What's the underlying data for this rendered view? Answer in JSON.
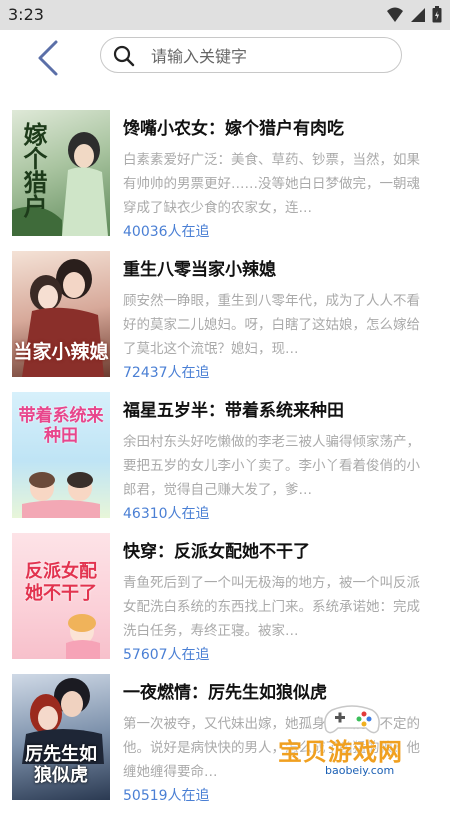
{
  "status_bar": {
    "time": "3:23"
  },
  "search": {
    "placeholder": "请输入关键字"
  },
  "books": [
    {
      "title": "馋嘴小农女：嫁个猎户有肉吃",
      "description": "白素素爱好广泛：美食、草药、钞票，当然，如果有帅帅的男票更好……没等她白日梦做完，一朝魂穿成了缺衣少食的农家女，连…",
      "readers": "40036人在追",
      "cover_text": "嫁个猎户"
    },
    {
      "title": "重生八零当家小辣媳",
      "description": "顾安然一睁眼，重生到八零年代，成为了人人不看好的莫家二儿媳妇。呀，白瞎了这姑娘，怎么嫁给了莫北这个流氓？媳妇，现…",
      "readers": "72437人在追",
      "cover_text": "当家小辣媳"
    },
    {
      "title": "福星五岁半：带着系统来种田",
      "description": "余田村东头好吃懒做的李老三被人骗得倾家荡产，要把五岁的女儿李小丫卖了。李小丫看着俊俏的小郎君，觉得自己赚大发了，爹…",
      "readers": "46310人在追",
      "cover_text": "带着系统来种田"
    },
    {
      "title": "快穿：反派女配她不干了",
      "description": "青鱼死后到了一个叫无极海的地方，被一个叫反派女配洗白系统的东西找上门来。系统承诺她：完成洗白任务，寿终正寝。被家…",
      "readers": "57607人在追",
      "cover_text": "反派女配她不干了"
    },
    {
      "title": "一夜燃情：厉先生如狼似虎",
      "description": "第一次被夺，又代妹出嫁，她孤身一人阴晴不定的他。说好是病快快的男人，怎么成了凶猛的狼？他缠她缠得要命…",
      "readers": "50519人在追",
      "cover_text": "厉先生如狼似虎"
    }
  ],
  "watermark": {
    "text": "宝贝游戏网",
    "url": "baobeiy.com"
  },
  "colors": {
    "accent": "#4a7fd4",
    "status_bar": "#e0e0e0",
    "back_arrow": "#5b6fa8"
  }
}
